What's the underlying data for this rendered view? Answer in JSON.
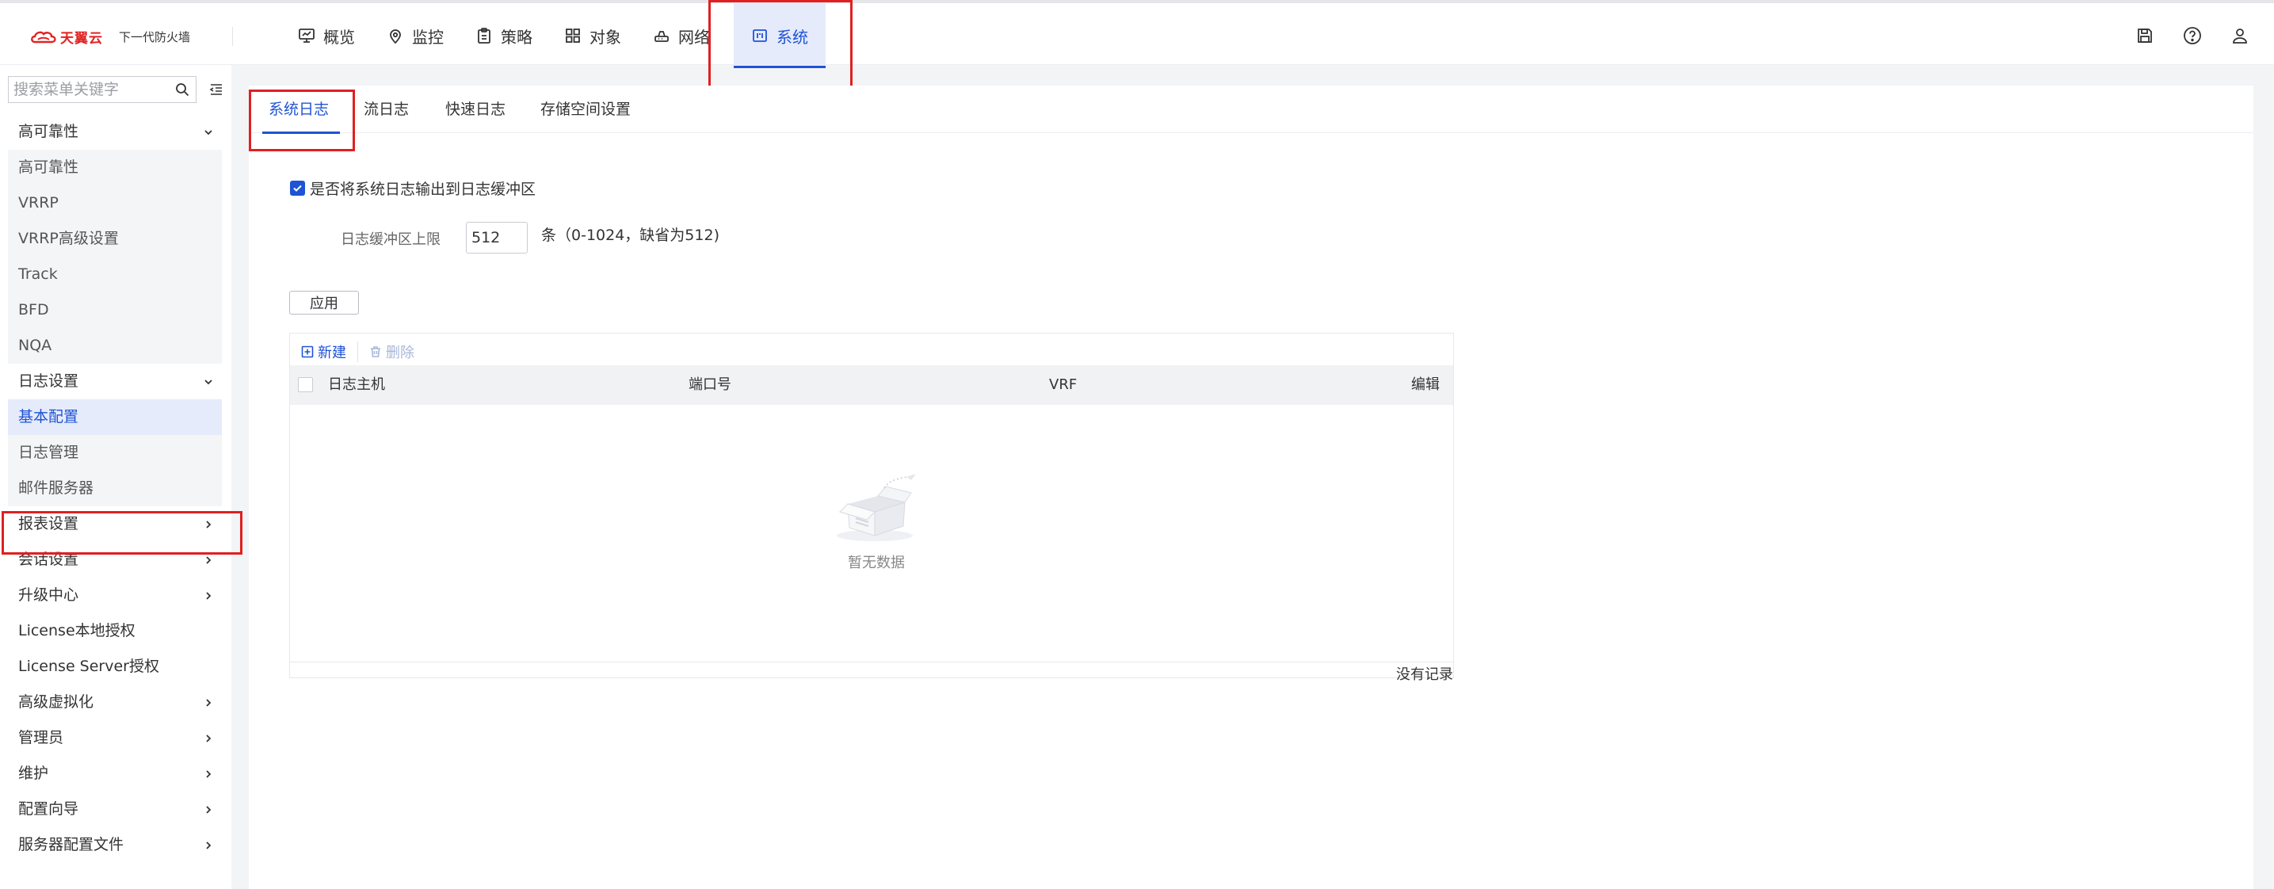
{
  "header": {
    "brand": "天翼云",
    "product": "下一代防火墙",
    "nav": [
      {
        "label": "概览",
        "icon": "monitor-icon"
      },
      {
        "label": "监控",
        "icon": "location-icon"
      },
      {
        "label": "策略",
        "icon": "clipboard-icon"
      },
      {
        "label": "对象",
        "icon": "grid-icon"
      },
      {
        "label": "网络",
        "icon": "router-icon"
      },
      {
        "label": "系统",
        "icon": "system-icon",
        "active": true
      }
    ],
    "right_icons": [
      "save-icon",
      "help-icon",
      "user-icon"
    ]
  },
  "sidebar": {
    "search_placeholder": "搜索菜单关键字",
    "items": [
      {
        "label": "高可靠性",
        "type": "group",
        "expanded": true
      },
      {
        "label": "高可靠性",
        "type": "child"
      },
      {
        "label": "VRRP",
        "type": "child"
      },
      {
        "label": "VRRP高级设置",
        "type": "child"
      },
      {
        "label": "Track",
        "type": "child"
      },
      {
        "label": "BFD",
        "type": "child"
      },
      {
        "label": "NQA",
        "type": "child"
      },
      {
        "label": "日志设置",
        "type": "group",
        "expanded": true
      },
      {
        "label": "基本配置",
        "type": "child",
        "active": true
      },
      {
        "label": "日志管理",
        "type": "child"
      },
      {
        "label": "邮件服务器",
        "type": "child"
      },
      {
        "label": "报表设置",
        "type": "group",
        "expanded": false
      },
      {
        "label": "会话设置",
        "type": "group",
        "expanded": false
      },
      {
        "label": "升级中心",
        "type": "group",
        "expanded": false
      },
      {
        "label": "License本地授权",
        "type": "leaf"
      },
      {
        "label": "License Server授权",
        "type": "leaf"
      },
      {
        "label": "高级虚拟化",
        "type": "group",
        "expanded": false
      },
      {
        "label": "管理员",
        "type": "group",
        "expanded": false
      },
      {
        "label": "维护",
        "type": "group",
        "expanded": false
      },
      {
        "label": "配置向导",
        "type": "group",
        "expanded": false
      },
      {
        "label": "服务器配置文件",
        "type": "group",
        "expanded": false
      }
    ]
  },
  "tabs": [
    "系统日志",
    "流日志",
    "快速日志",
    "存储空间设置"
  ],
  "form": {
    "checkbox_label": "是否将系统日志输出到日志缓冲区",
    "checkbox_checked": true,
    "limit_label": "日志缓冲区上限",
    "limit_value": "512",
    "limit_hint": "条（0-1024，缺省为512)",
    "apply_label": "应用"
  },
  "table": {
    "new_label": "新建",
    "delete_label": "删除",
    "columns": [
      "日志主机",
      "端口号",
      "VRF",
      "编辑"
    ],
    "rows": [],
    "empty_text": "暂无数据",
    "footer": "没有记录"
  },
  "colors": {
    "accent": "#1f53d6",
    "active_bg": "#e5ebfa",
    "highlight": "#e02020",
    "brand_red": "#e02424"
  }
}
